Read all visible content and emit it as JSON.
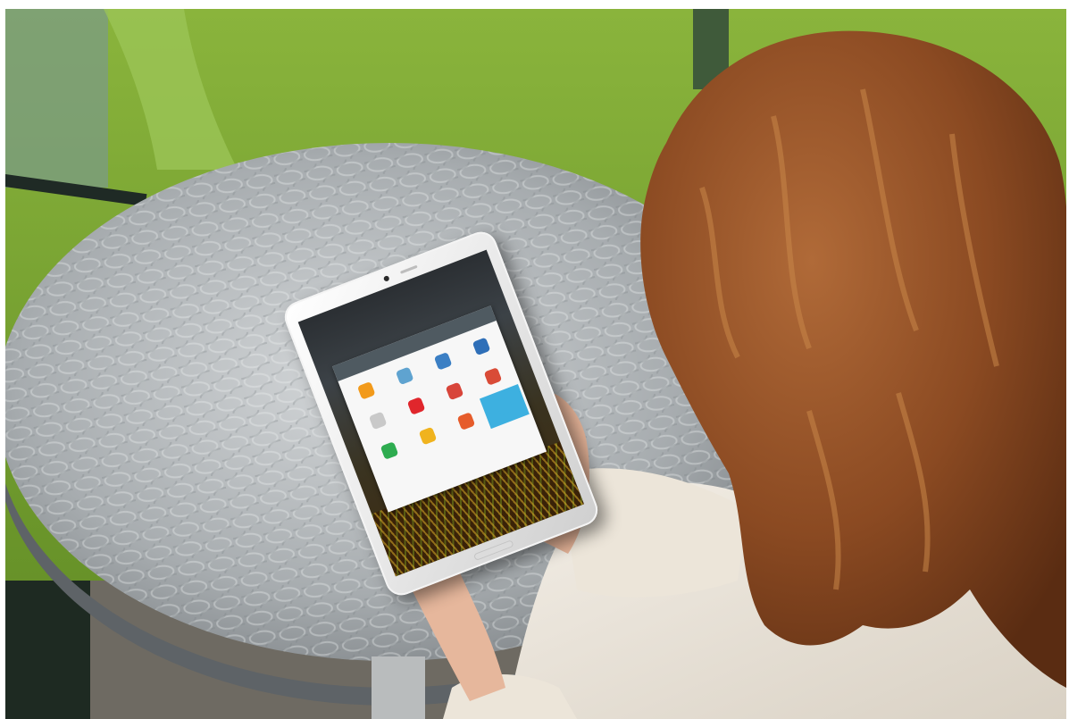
{
  "colors": {
    "lawn": "#6f9a2e",
    "table_metal": "#a9adb0",
    "hair": "#8a4a22",
    "sweater": "#ede7dc",
    "skin": "#e5b59a",
    "selected_tile": "#3db0e0"
  },
  "tablet": {
    "share_sheet": {
      "apps": [
        {
          "icon": "chat-bubble-icon",
          "color": "#f29a1b"
        },
        {
          "icon": "image-icon",
          "color": "#5fa3d0"
        },
        {
          "icon": "dropbox-icon",
          "color": "#3b7fc4"
        },
        {
          "icon": "bluetooth-icon",
          "color": "#2f6fb8"
        },
        {
          "icon": "envelope-icon",
          "color": "#c9c9c9"
        },
        {
          "icon": "flipboard-icon",
          "color": "#e0262c"
        },
        {
          "icon": "gmail-icon",
          "color": "#d8453a"
        },
        {
          "icon": "google-plus-icon",
          "color": "#d94b37"
        },
        {
          "icon": "hangouts-icon",
          "color": "#2eac50"
        },
        {
          "icon": "photos-icon",
          "color": "#f0b31e"
        },
        {
          "icon": "picasa-icon",
          "color": "#e65c2b"
        },
        {
          "icon": "twitter-icon",
          "color": "#3db0e0"
        }
      ]
    }
  }
}
